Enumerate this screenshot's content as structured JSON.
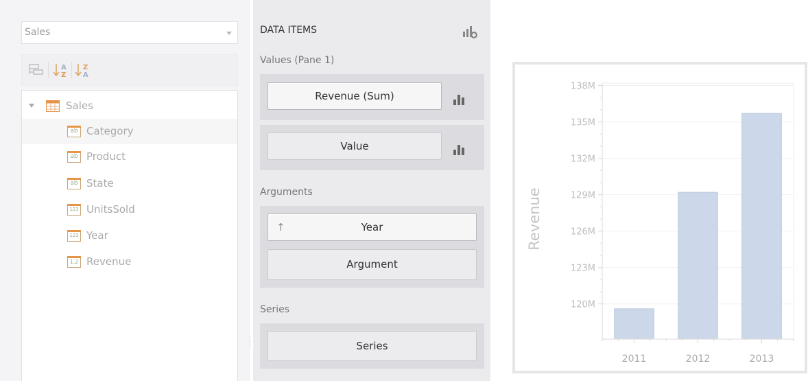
{
  "left": {
    "datasource": "Sales",
    "tree": {
      "root_label": "Sales",
      "fields": [
        {
          "label": "Category",
          "icon": "string-field-icon",
          "glyph": "ab"
        },
        {
          "label": "Product",
          "icon": "string-field-icon",
          "glyph": "ab"
        },
        {
          "label": "State",
          "icon": "string-field-icon",
          "glyph": "ab"
        },
        {
          "label": "UnitsSold",
          "icon": "integer-field-icon",
          "glyph": "123"
        },
        {
          "label": "Year",
          "icon": "integer-field-icon",
          "glyph": "123"
        },
        {
          "label": "Revenue",
          "icon": "decimal-field-icon",
          "glyph": "1,2"
        }
      ]
    }
  },
  "middle": {
    "data_items_title": "DATA ITEMS",
    "values_section": "Values (Pane 1)",
    "values": [
      "Revenue (Sum)",
      "Value"
    ],
    "arguments_section": "Arguments",
    "arguments": [
      "Year",
      "Argument"
    ],
    "series_section": "Series",
    "series": [
      "Series"
    ]
  },
  "chart_data": {
    "type": "bar",
    "ylabel": "Revenue",
    "categories": [
      "2011",
      "2012",
      "2013"
    ],
    "values": [
      119.6,
      129.2,
      135.7
    ],
    "yticks": [
      "120M",
      "123M",
      "126M",
      "129M",
      "132M",
      "135M",
      "138M"
    ],
    "ylim": [
      117.1,
      138.2
    ],
    "bar_color": "#ccd8e9"
  },
  "colors": {
    "bar": "#ccd8e9",
    "bar_stroke": "#b9c9df",
    "field_icon": "#e59548"
  }
}
